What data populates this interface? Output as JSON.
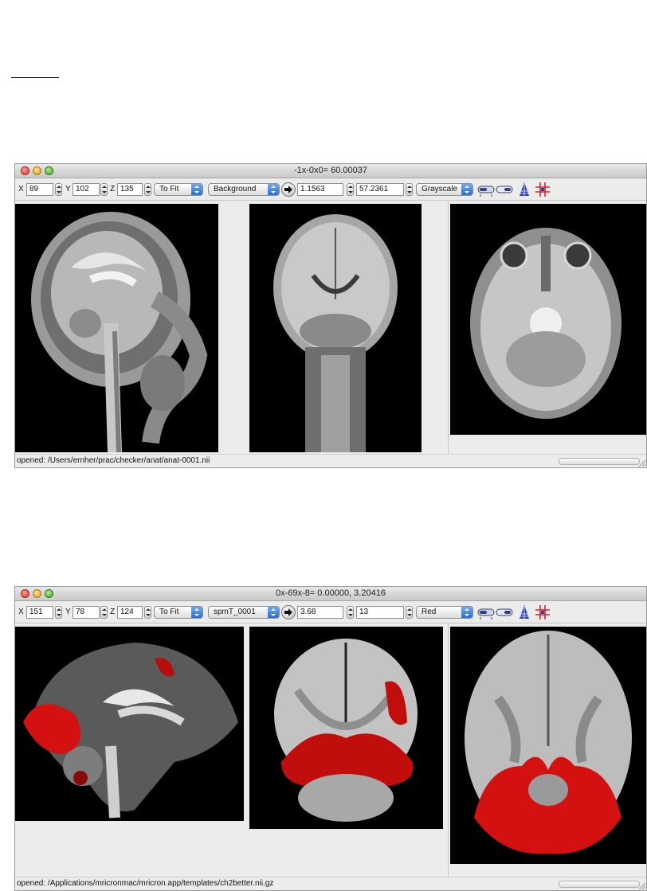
{
  "windows": [
    {
      "title": "-1x-0x0= 60.00037",
      "coords": {
        "x_label": "X",
        "x_value": "89",
        "y_label": "Y",
        "y_value": "102",
        "z_label": "Z",
        "z_value": "135"
      },
      "zoom": "To Fit",
      "layer": "Background",
      "min_value": "1.1563",
      "max_value": "57.2361",
      "colormap": "Grayscale",
      "status": "opened: /Users/ernher/prac/checker/anat/anat-0001.nii"
    },
    {
      "title": "0x-69x-8= 0.00000, 3.20416",
      "coords": {
        "x_label": "X",
        "x_value": "151",
        "y_label": "Y",
        "y_value": "78",
        "z_label": "Z",
        "z_value": "124"
      },
      "zoom": "To Fit",
      "layer": "spmT_0001",
      "min_value": "3.68",
      "max_value": "13",
      "colormap": "Red",
      "status": "opened: /Applications/mricronmac/mricron.app/templates/ch2better.nii.gz"
    }
  ],
  "icons": {
    "stepper": "stepper-arrows-icon",
    "arrow_button": "arrow-right-icon",
    "slider_a": "slider-toggle-icon",
    "slider_b": "slider-bar-icon",
    "pyramid": "render-pyramid-icon",
    "crosshair": "crosshair-grid-icon"
  },
  "colors": {
    "overlay": "#d41010",
    "crosshair": "#e0202b",
    "accent": "#2a6ed6"
  }
}
